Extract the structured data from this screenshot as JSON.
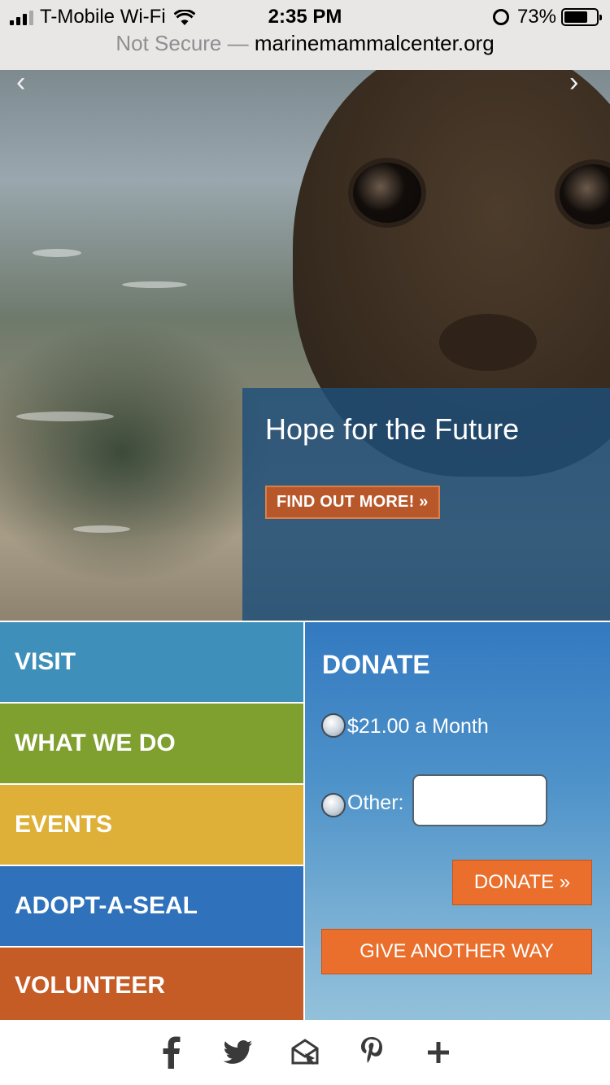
{
  "status_bar": {
    "carrier": "T-Mobile Wi-Fi",
    "time": "2:35 PM",
    "battery": "73%",
    "battery_level": 0.73
  },
  "url_bar": {
    "security": "Not Secure",
    "separator": "—",
    "host": "marinemammalcenter.org"
  },
  "hero": {
    "title": "Hope for the Future",
    "cta_label": "FIND OUT MORE! »",
    "prev_icon": "chevron-left-icon",
    "next_icon": "chevron-right-icon"
  },
  "nav_tiles": [
    {
      "label": "VISIT",
      "color": "#3e8fb9"
    },
    {
      "label": "WHAT WE DO",
      "color": "#7f9f2e"
    },
    {
      "label": "EVENTS",
      "color": "#dfb037"
    },
    {
      "label": "ADOPT-A-SEAL",
      "color": "#2f72bb"
    },
    {
      "label": "VOLUNTEER",
      "color": "#c55b25"
    }
  ],
  "donate": {
    "title": "DONATE",
    "option_monthly": "$21.00 a Month",
    "option_other": "Other:",
    "other_value": "",
    "submit_label": "DONATE »",
    "alt_label": "GIVE ANOTHER WAY",
    "accent": "#ea6f2c"
  },
  "share_bar": {
    "icons": [
      "facebook-icon",
      "twitter-icon",
      "email-icon",
      "pinterest-icon",
      "plus-icon"
    ]
  }
}
